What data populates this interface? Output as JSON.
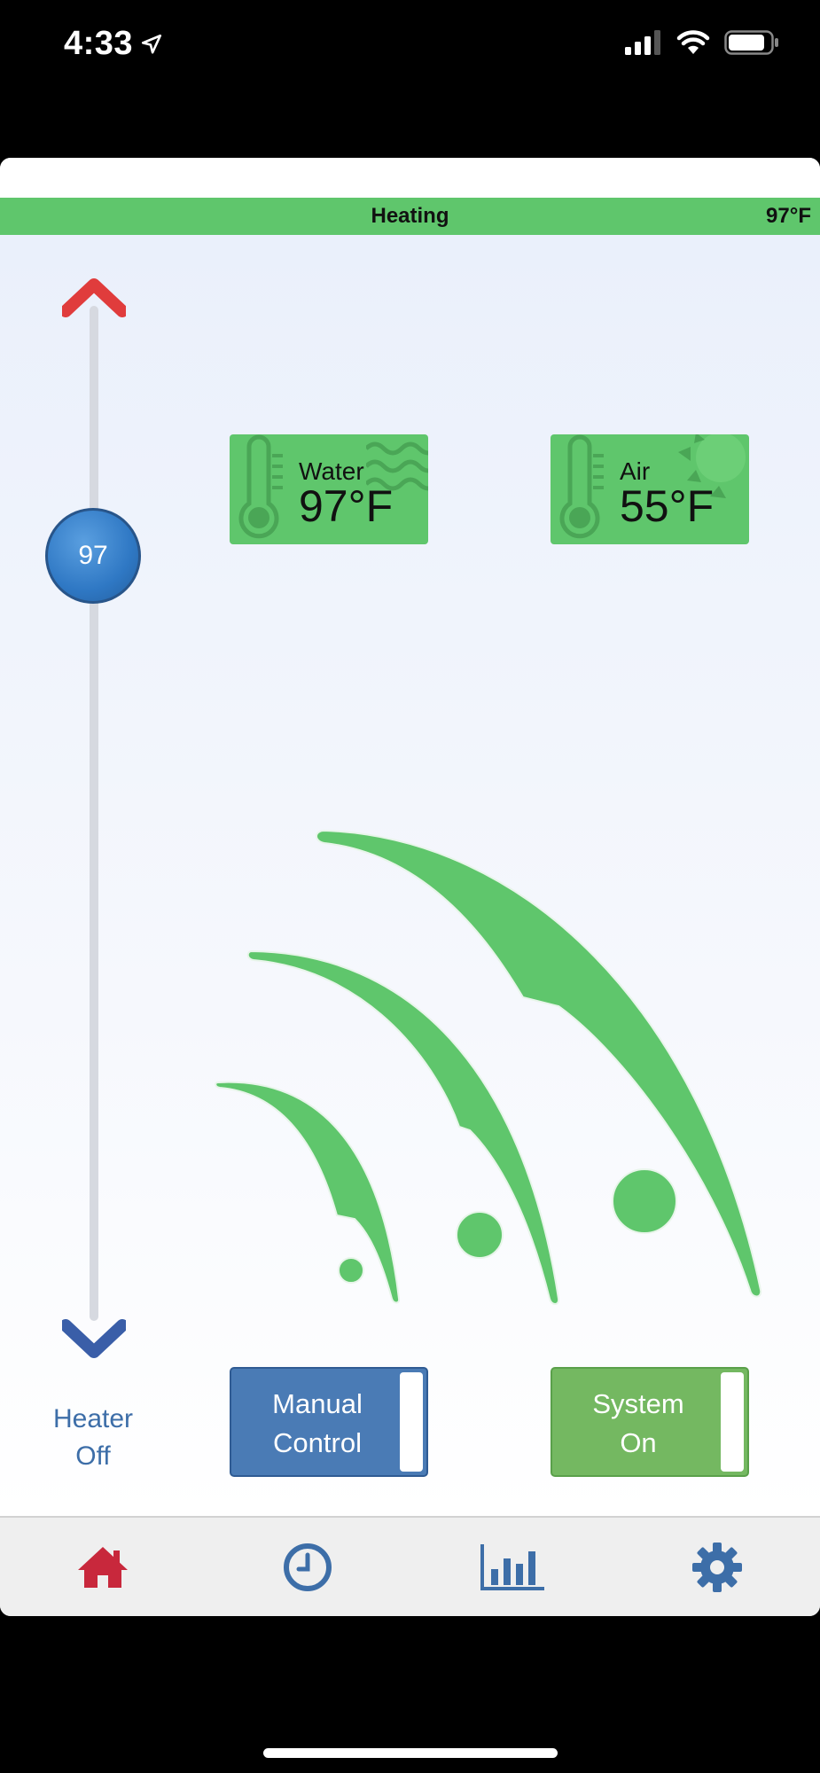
{
  "status_bar": {
    "time": "4:33"
  },
  "header": {
    "mode": "Heating",
    "temperature": "97°F"
  },
  "setpoint": {
    "value": "97",
    "heater_status_line1": "Heater",
    "heater_status_line2": "Off"
  },
  "tiles": {
    "water": {
      "label": "Water",
      "value": "97°F"
    },
    "air": {
      "label": "Air",
      "value": "55°F"
    }
  },
  "toggles": {
    "manual": {
      "line1": "Manual",
      "line2": "Control"
    },
    "system": {
      "line1": "System",
      "line2": "On"
    }
  },
  "colors": {
    "accent_green": "#5fc66c",
    "toggle_blue": "#4a7bb5",
    "toggle_green": "#74b861",
    "tab_red": "#c8283c",
    "tab_blue": "#3d6ea8"
  },
  "tabbar": {
    "items": [
      {
        "icon": "home-icon"
      },
      {
        "icon": "clock-icon"
      },
      {
        "icon": "bar-chart-icon"
      },
      {
        "icon": "gear-icon"
      }
    ]
  }
}
